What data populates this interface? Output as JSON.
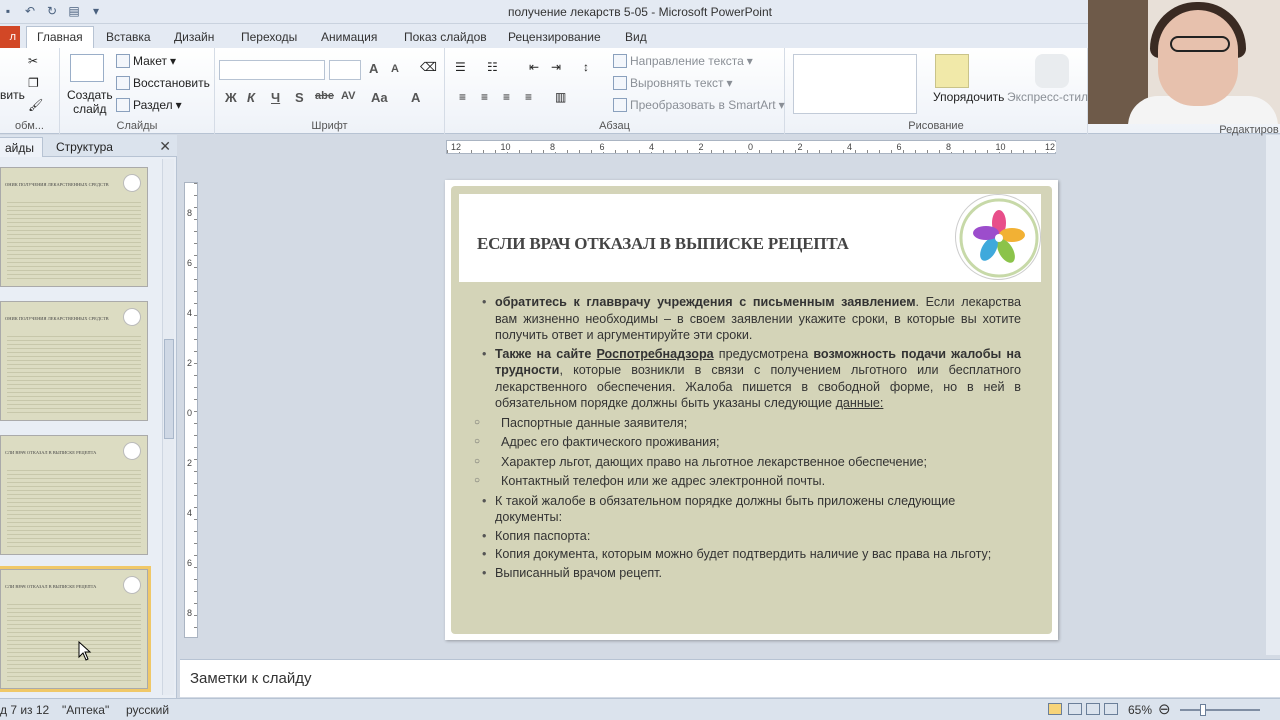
{
  "window": {
    "title": "получение лекарств 5-05  -  Microsoft PowerPoint"
  },
  "tabs": {
    "file": "л",
    "items": [
      "Главная",
      "Вставка",
      "Дизайн",
      "Переходы",
      "Анимация",
      "Показ слайдов",
      "Рецензирование",
      "Вид"
    ]
  },
  "ribbon": {
    "clipboard": {
      "label": "обм...",
      "paste": "вить"
    },
    "slides": {
      "label": "Слайды",
      "create": "Создать слайд",
      "layout": "Макет",
      "reset": "Восстановить",
      "section": "Раздел"
    },
    "font": {
      "label": "Шрифт",
      "bold": "Ж",
      "italic": "К",
      "underline": "Ч",
      "shadow": "S",
      "strike": "abe",
      "spacing": "AV",
      "case": "Aa",
      "color": "A",
      "grow": "A",
      "shrink": "A"
    },
    "paragraph": {
      "label": "Абзац",
      "direction": "Направление текста",
      "align": "Выровнять текст",
      "smartart": "Преобразовать в SmartArt"
    },
    "drawing": {
      "label": "Рисование",
      "arrange": "Упорядочить",
      "styles": "Экспресс-стили"
    },
    "editing": {
      "label": "Редактиров"
    }
  },
  "left_pane": {
    "tab_slides": "айды",
    "tab_outline": "Структура",
    "close": "✕",
    "thumbnails": [
      {
        "title": "ОНИК   ПОЛУЧЕНИЯ   ЛЕКАРСТВЕННЫХ   СРЕДСТВ"
      },
      {
        "title": "ОНИК   ПОЛУЧЕНИЯ   ЛЕКАРСТВЕННЫХ   СРЕДСТВ"
      },
      {
        "title": "СЛИ ВРАЧ ОТКАЗАЛ В ВЫПИСКЕ РЕЦЕПТА"
      },
      {
        "title": "СЛИ ВРАЧ ОТКАЗАЛ В ВЫПИСКЕ РЕЦЕПТА"
      }
    ]
  },
  "slide": {
    "title": "ЕСЛИ ВРАЧ ОТКАЗАЛ В ВЫПИСКЕ РЕЦЕПТА",
    "b1_bold": "обратитесь к главврачу учреждения с письменным заявлением",
    "b1_rest": ". Если лекарства вам жизненно необходимы – в своем заявлении укажите сроки, в которые вы хотите получить ответ и аргументируйте эти сроки.",
    "b2_bold1": "Также на сайте ",
    "b2_bold_u": "Роспотребнадзора",
    "b2_mid": " предусмотрена ",
    "b2_bold2": "возможность подачи жалобы на трудности",
    "b2_rest": ", которые возникли в связи с получением льготного или бесплатного лекарственного обеспечения. Жалоба пишется в свободной форме, но в ней в обязательном порядке должны быть указаны следующие ",
    "b2_link": "данные:",
    "sub_items": [
      "Паспортные данные заявителя;",
      "Адрес его фактического проживания;",
      "Характер льгот, дающих право на льготное лекарственное обеспечение;",
      "Контактный телефон или же адрес электронной почты."
    ],
    "items_after": [
      "К такой жалобе в обязательном порядке должны быть приложены следующие документы:",
      "Копия паспорта:",
      "Копия документа, которым можно будет подтвердить наличие у вас права на льготу;",
      "Выписанный врачом рецепт."
    ]
  },
  "notes": {
    "placeholder": "Заметки к слайду"
  },
  "status": {
    "slide": "д 7 из 12",
    "theme": "\"Аптека\"",
    "language": "русский",
    "zoom": "65%"
  },
  "hruler_labels": [
    "12",
    "10",
    "8",
    "6",
    "4",
    "2",
    "0",
    "2",
    "4",
    "6",
    "8",
    "10",
    "12"
  ],
  "vruler_labels": [
    "8",
    "6",
    "4",
    "2",
    "0",
    "2",
    "4",
    "6",
    "8"
  ]
}
